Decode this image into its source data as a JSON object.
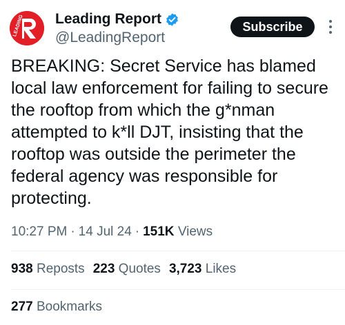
{
  "author": {
    "display_name": "Leading Report",
    "handle": "@LeadingReport",
    "avatar_text": "LEADING",
    "avatar_letter": "R",
    "verified_icon": "verified-badge-icon",
    "brand_color": "#e21f26",
    "verified_color": "#1d9bf0"
  },
  "actions": {
    "subscribe_label": "Subscribe",
    "more_icon": "more-options-icon"
  },
  "tweet": {
    "text": "BREAKING: Secret Service has blamed local law enforcement for failing to secure the rooftop from which the g*nman attempted to k*ll DJT, insisting that the rooftop was outside the perimeter the federal agency was responsible for protecting.",
    "time": "10:27 PM",
    "date": "14 Jul 24",
    "views_count": "151K",
    "views_label": "Views",
    "separator": "·"
  },
  "stats": {
    "reposts_count": "938",
    "reposts_label": "Reposts",
    "quotes_count": "223",
    "quotes_label": "Quotes",
    "likes_count": "3,723",
    "likes_label": "Likes",
    "bookmarks_count": "277",
    "bookmarks_label": "Bookmarks"
  }
}
